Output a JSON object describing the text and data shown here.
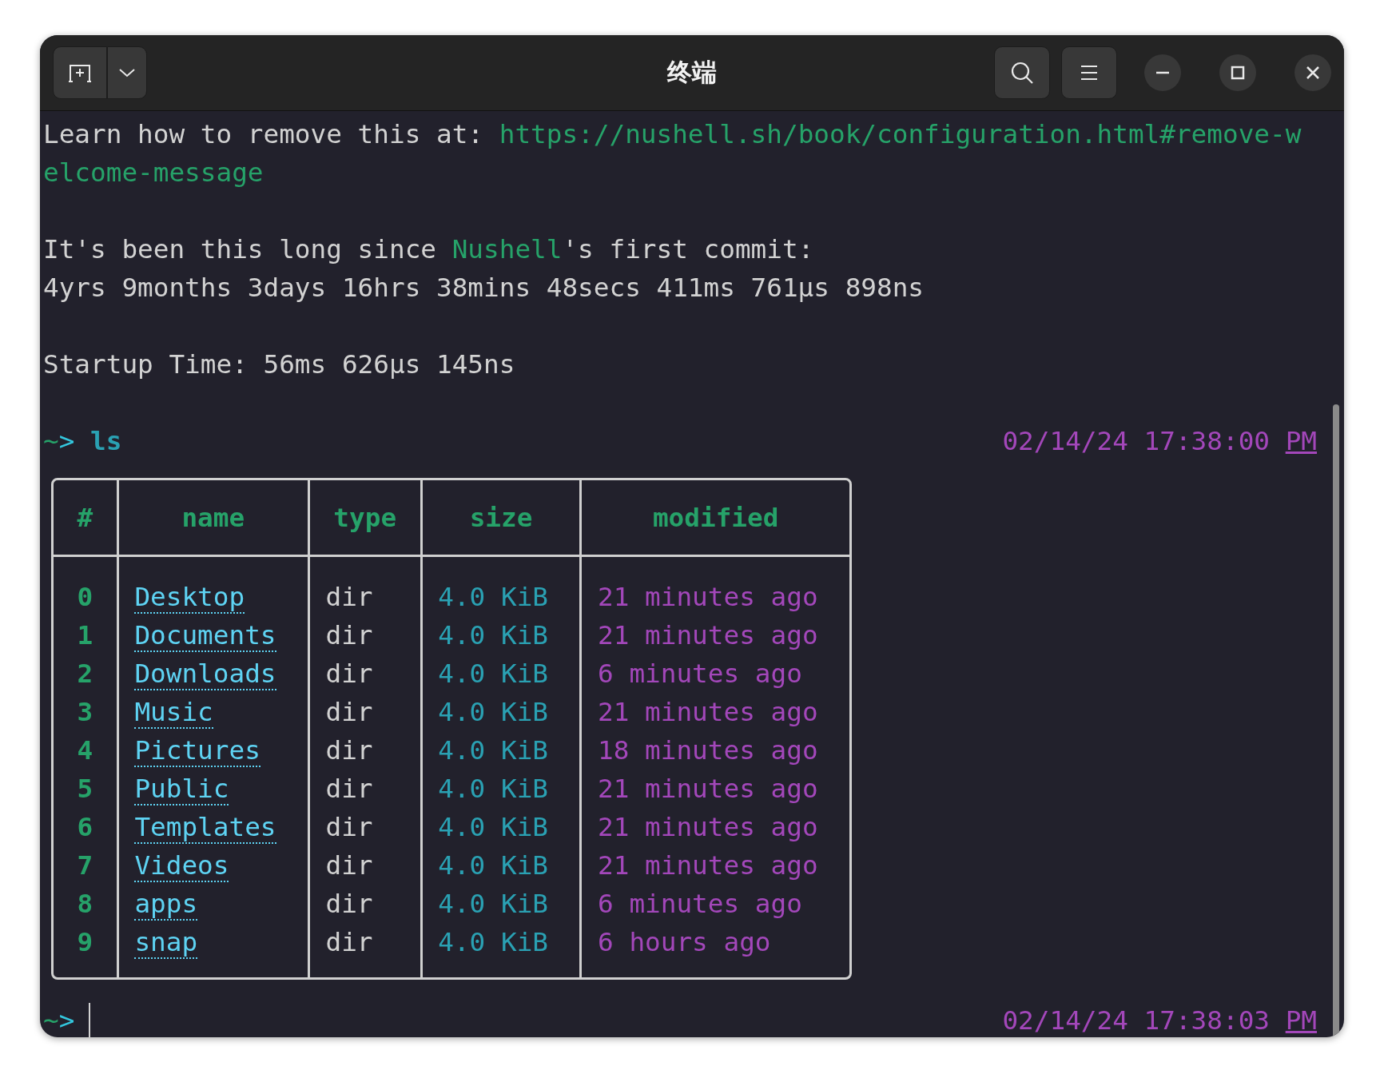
{
  "window": {
    "title": "终端"
  },
  "welcome": {
    "text": "Learn how to remove this at: ",
    "link": "https://nushell.sh/book/configuration.html#remove-welcome-message"
  },
  "commit_age": {
    "before": "It's been this long since ",
    "name": "Nushell",
    "after": "'s first commit:"
  },
  "uptime": "4yrs 9months 3days 16hrs 38mins 48secs 411ms 761µs 898ns",
  "startup": "Startup Time: 56ms 626µs 145ns",
  "prompts": [
    {
      "home": "~",
      "arrow": ">",
      "command": "ls",
      "timestamp": "02/14/24 17:38:00",
      "meridiem": "PM"
    },
    {
      "home": "~",
      "arrow": ">",
      "timestamp": "02/14/24 17:38:03",
      "meridiem": "PM"
    }
  ],
  "table": {
    "columns": [
      "#",
      "name",
      "type",
      "size",
      "modified"
    ],
    "rows": [
      {
        "index": "0",
        "name": "Desktop",
        "type": "dir",
        "size": "4.0 KiB",
        "modified": "21 minutes ago"
      },
      {
        "index": "1",
        "name": "Documents",
        "type": "dir",
        "size": "4.0 KiB",
        "modified": "21 minutes ago"
      },
      {
        "index": "2",
        "name": "Downloads",
        "type": "dir",
        "size": "4.0 KiB",
        "modified": "6 minutes ago"
      },
      {
        "index": "3",
        "name": "Music",
        "type": "dir",
        "size": "4.0 KiB",
        "modified": "21 minutes ago"
      },
      {
        "index": "4",
        "name": "Pictures",
        "type": "dir",
        "size": "4.0 KiB",
        "modified": "18 minutes ago"
      },
      {
        "index": "5",
        "name": "Public",
        "type": "dir",
        "size": "4.0 KiB",
        "modified": "21 minutes ago"
      },
      {
        "index": "6",
        "name": "Templates",
        "type": "dir",
        "size": "4.0 KiB",
        "modified": "21 minutes ago"
      },
      {
        "index": "7",
        "name": "Videos",
        "type": "dir",
        "size": "4.0 KiB",
        "modified": "21 minutes ago"
      },
      {
        "index": "8",
        "name": "apps",
        "type": "dir",
        "size": "4.0 KiB",
        "modified": "6 minutes ago"
      },
      {
        "index": "9",
        "name": "snap",
        "type": "dir",
        "size": "4.0 KiB",
        "modified": "6 hours ago"
      }
    ]
  }
}
